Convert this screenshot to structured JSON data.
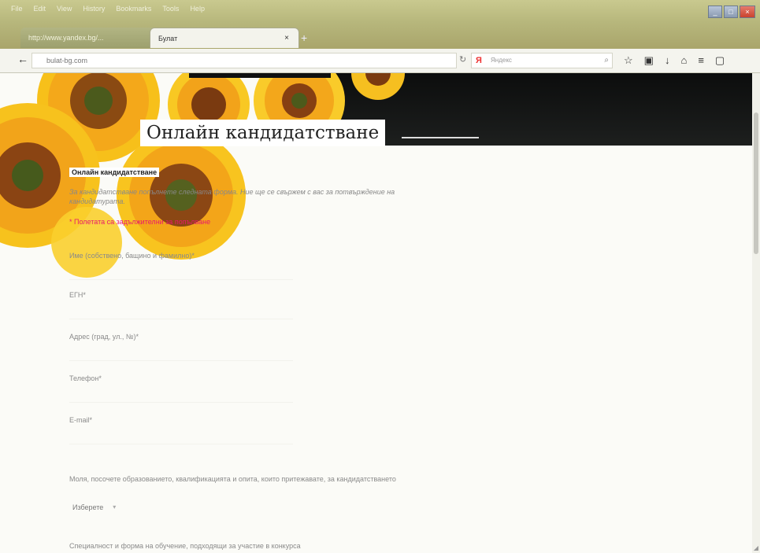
{
  "browser": {
    "menu": [
      "File",
      "Edit",
      "View",
      "History",
      "Bookmarks",
      "Tools",
      "Help"
    ],
    "tabs": [
      {
        "label": "http://www.yandex.bg/...",
        "active": false
      },
      {
        "label": "Булат",
        "active": true
      }
    ],
    "close_label": "×",
    "new_tab_label": "+",
    "url": "bulat-bg.com",
    "search_placeholder": "Яндекс",
    "window_controls": [
      "_",
      "□",
      "×"
    ]
  },
  "page": {
    "title": "Онлайн кандидатстване",
    "form_heading": "Онлайн кандидатстване",
    "intro": "За кандидатстване попълнете следната форма. Ние ще се свържем с вас за потвърждение на кандидатурата.",
    "required_note": "* Полетата са задължителни за попълване",
    "fields": [
      {
        "label": "Име (собствено, бащино и фамилно)*"
      },
      {
        "label": "ЕГН*"
      },
      {
        "label": "Адрес (град, ул., №)*"
      },
      {
        "label": "Телефон*"
      },
      {
        "label": "E-mail*"
      }
    ],
    "education_label": "Моля, посочете образованието, квалификацията и опита, които притежавате, за кандидатстването",
    "education_select_value": "Изберете",
    "bottom_label": "Специалност и форма на обучение, подходящи за участие в конкурса"
  },
  "colors": {
    "required": "#e8186c",
    "banner": "#0c0d0d",
    "chrome": "#b7b77c"
  }
}
